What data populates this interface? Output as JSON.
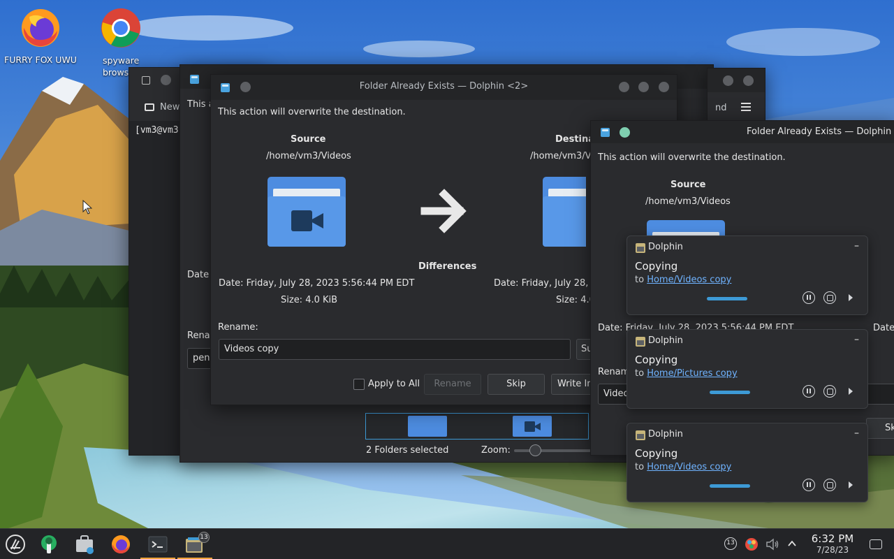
{
  "desktop": {
    "icons": [
      {
        "label": "FURRY FOX UWU",
        "icon": "firefox-icon"
      },
      {
        "label": "spyware browser",
        "icon": "chrome-icon"
      }
    ]
  },
  "terminal_bg": {
    "new_tab": "New",
    "prompt": "[vm3@vm3"
  },
  "dolphin_bg": {
    "line": "This a",
    "date": "Date",
    "rename": "Rena",
    "rename_val": "pen",
    "status": "2 Folders selected",
    "zoom": "Zoom:",
    "find": "nd"
  },
  "dialog_main": {
    "title": "Folder Already Exists — Dolphin <2>",
    "warning": "This action will overwrite the destination.",
    "source_label": "Source",
    "source_path": "/home/vm3/Videos",
    "dest_label": "Destina",
    "dest_path": "/home/vm3/V",
    "differences": "Differences",
    "src_date": "Date: Friday, July 28, 2023 5:56:44 PM EDT",
    "src_size": "Size: 4.0 KiB",
    "dst_date": "Date: Friday, July 28, 2",
    "dst_size": "Size: 4.0",
    "rename_label": "Rename:",
    "rename_value": "Videos copy",
    "suggest_btn": "Su",
    "apply_all": "Apply to All",
    "rename_btn": "Rename",
    "skip_btn": "Skip",
    "write_btn": "Write In"
  },
  "dialog_second": {
    "title": "Folder Already Exists — Dolphin",
    "warning": "This action will overwrite the destination.",
    "source_label": "Source",
    "source_path": "/home/vm3/Videos",
    "date": "Date: Friday, July 28, 2023 5:56:44 PM EDT",
    "date_right": "Date:",
    "rename_label": "Renam",
    "rename_value": "Video",
    "skip_btn": "Sk"
  },
  "notifications": [
    {
      "app": "Dolphin",
      "heading": "Copying",
      "prefix": "to",
      "link": "Home/Videos copy"
    },
    {
      "app": "Dolphin",
      "heading": "Copying",
      "prefix": "to",
      "link": "Home/Pictures copy"
    },
    {
      "app": "Dolphin",
      "heading": "Copying",
      "prefix": "to",
      "link": "Home/Videos copy"
    }
  ],
  "taskbar": {
    "badge_count": "13",
    "tray_badge": "13",
    "time": "6:32 PM",
    "date": "7/28/23"
  },
  "colors": {
    "accent": "#3d9ad6",
    "link": "#6fb3ff",
    "folder": "#5898e8"
  }
}
